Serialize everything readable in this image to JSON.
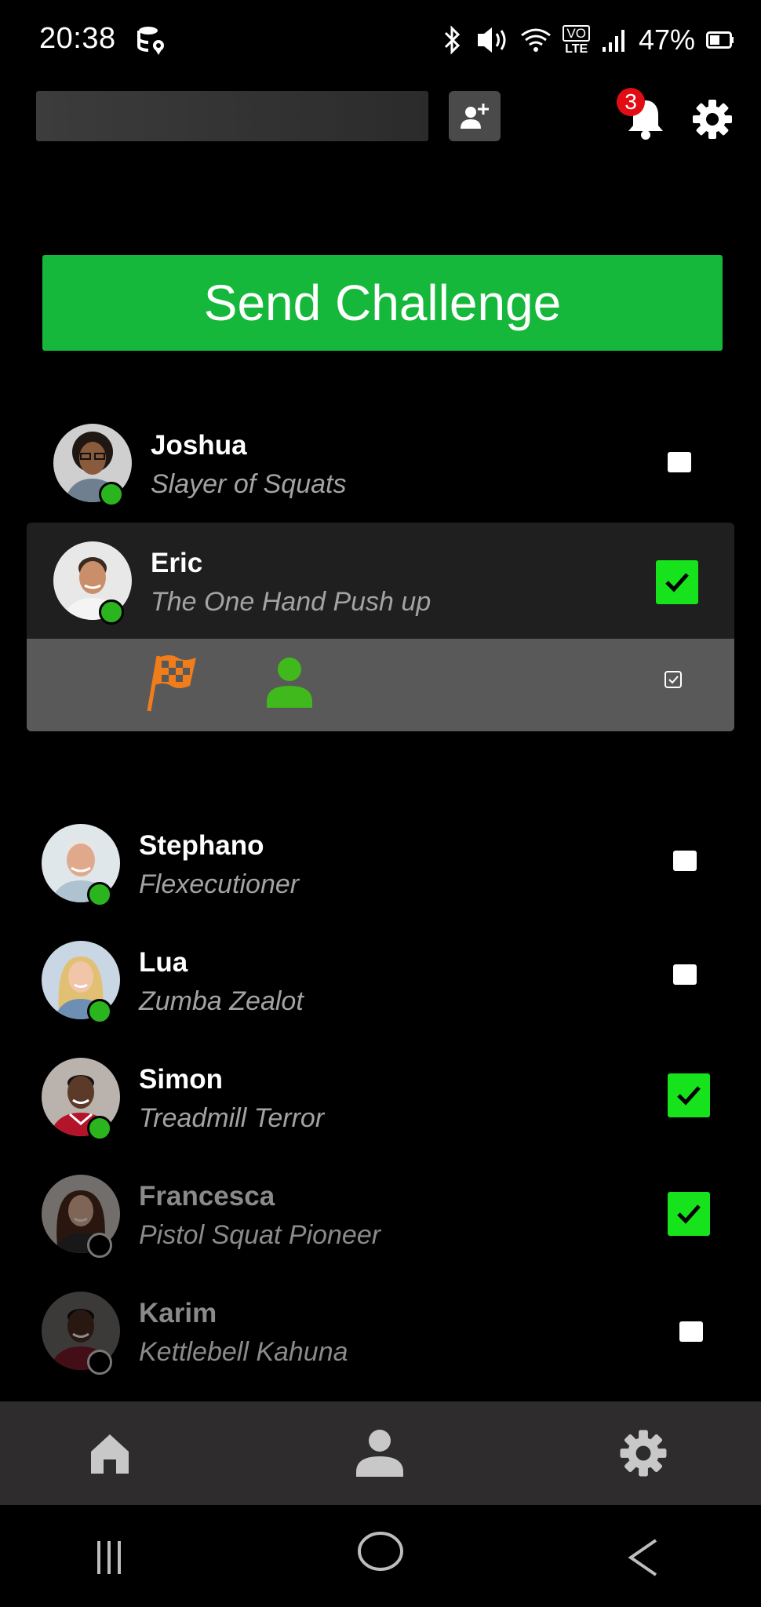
{
  "status_bar": {
    "time": "20:38",
    "battery": "47%",
    "icons": [
      "database-location-icon",
      "bluetooth-icon",
      "vibrate-icon",
      "wifi-icon",
      "volte-icon",
      "signal-icon",
      "battery-icon"
    ],
    "volte_top": "VO",
    "volte_bottom": "LTE"
  },
  "header": {
    "search_value": "",
    "notification_count": "3"
  },
  "send_button": {
    "label": "Send Challenge",
    "color": "#15b83a"
  },
  "friends": [
    {
      "name": "Joshua",
      "title": "Slayer of Squats",
      "online": true,
      "checked": false
    },
    {
      "name": "Eric",
      "title": "The One Hand Push up",
      "online": true,
      "checked": true,
      "expanded": true
    },
    {
      "name": "Stephano",
      "title": "Flexecutioner",
      "online": true,
      "checked": false
    },
    {
      "name": "Lua",
      "title": "Zumba Zealot",
      "online": true,
      "checked": false
    },
    {
      "name": "Simon",
      "title": "Treadmill Terror",
      "online": true,
      "checked": true
    },
    {
      "name": "Francesca",
      "title": "Pistol Squat Pioneer",
      "online": false,
      "checked": true
    },
    {
      "name": "Karim",
      "title": "Kettlebell Kahuna",
      "online": false,
      "checked": false
    }
  ],
  "colors": {
    "online": "#2ab51f",
    "checked": "#16e31b",
    "flag": "#f07d1a",
    "accent_green": "#15b83a"
  },
  "bottom_nav": [
    "home-icon",
    "profile-icon",
    "settings-icon"
  ]
}
